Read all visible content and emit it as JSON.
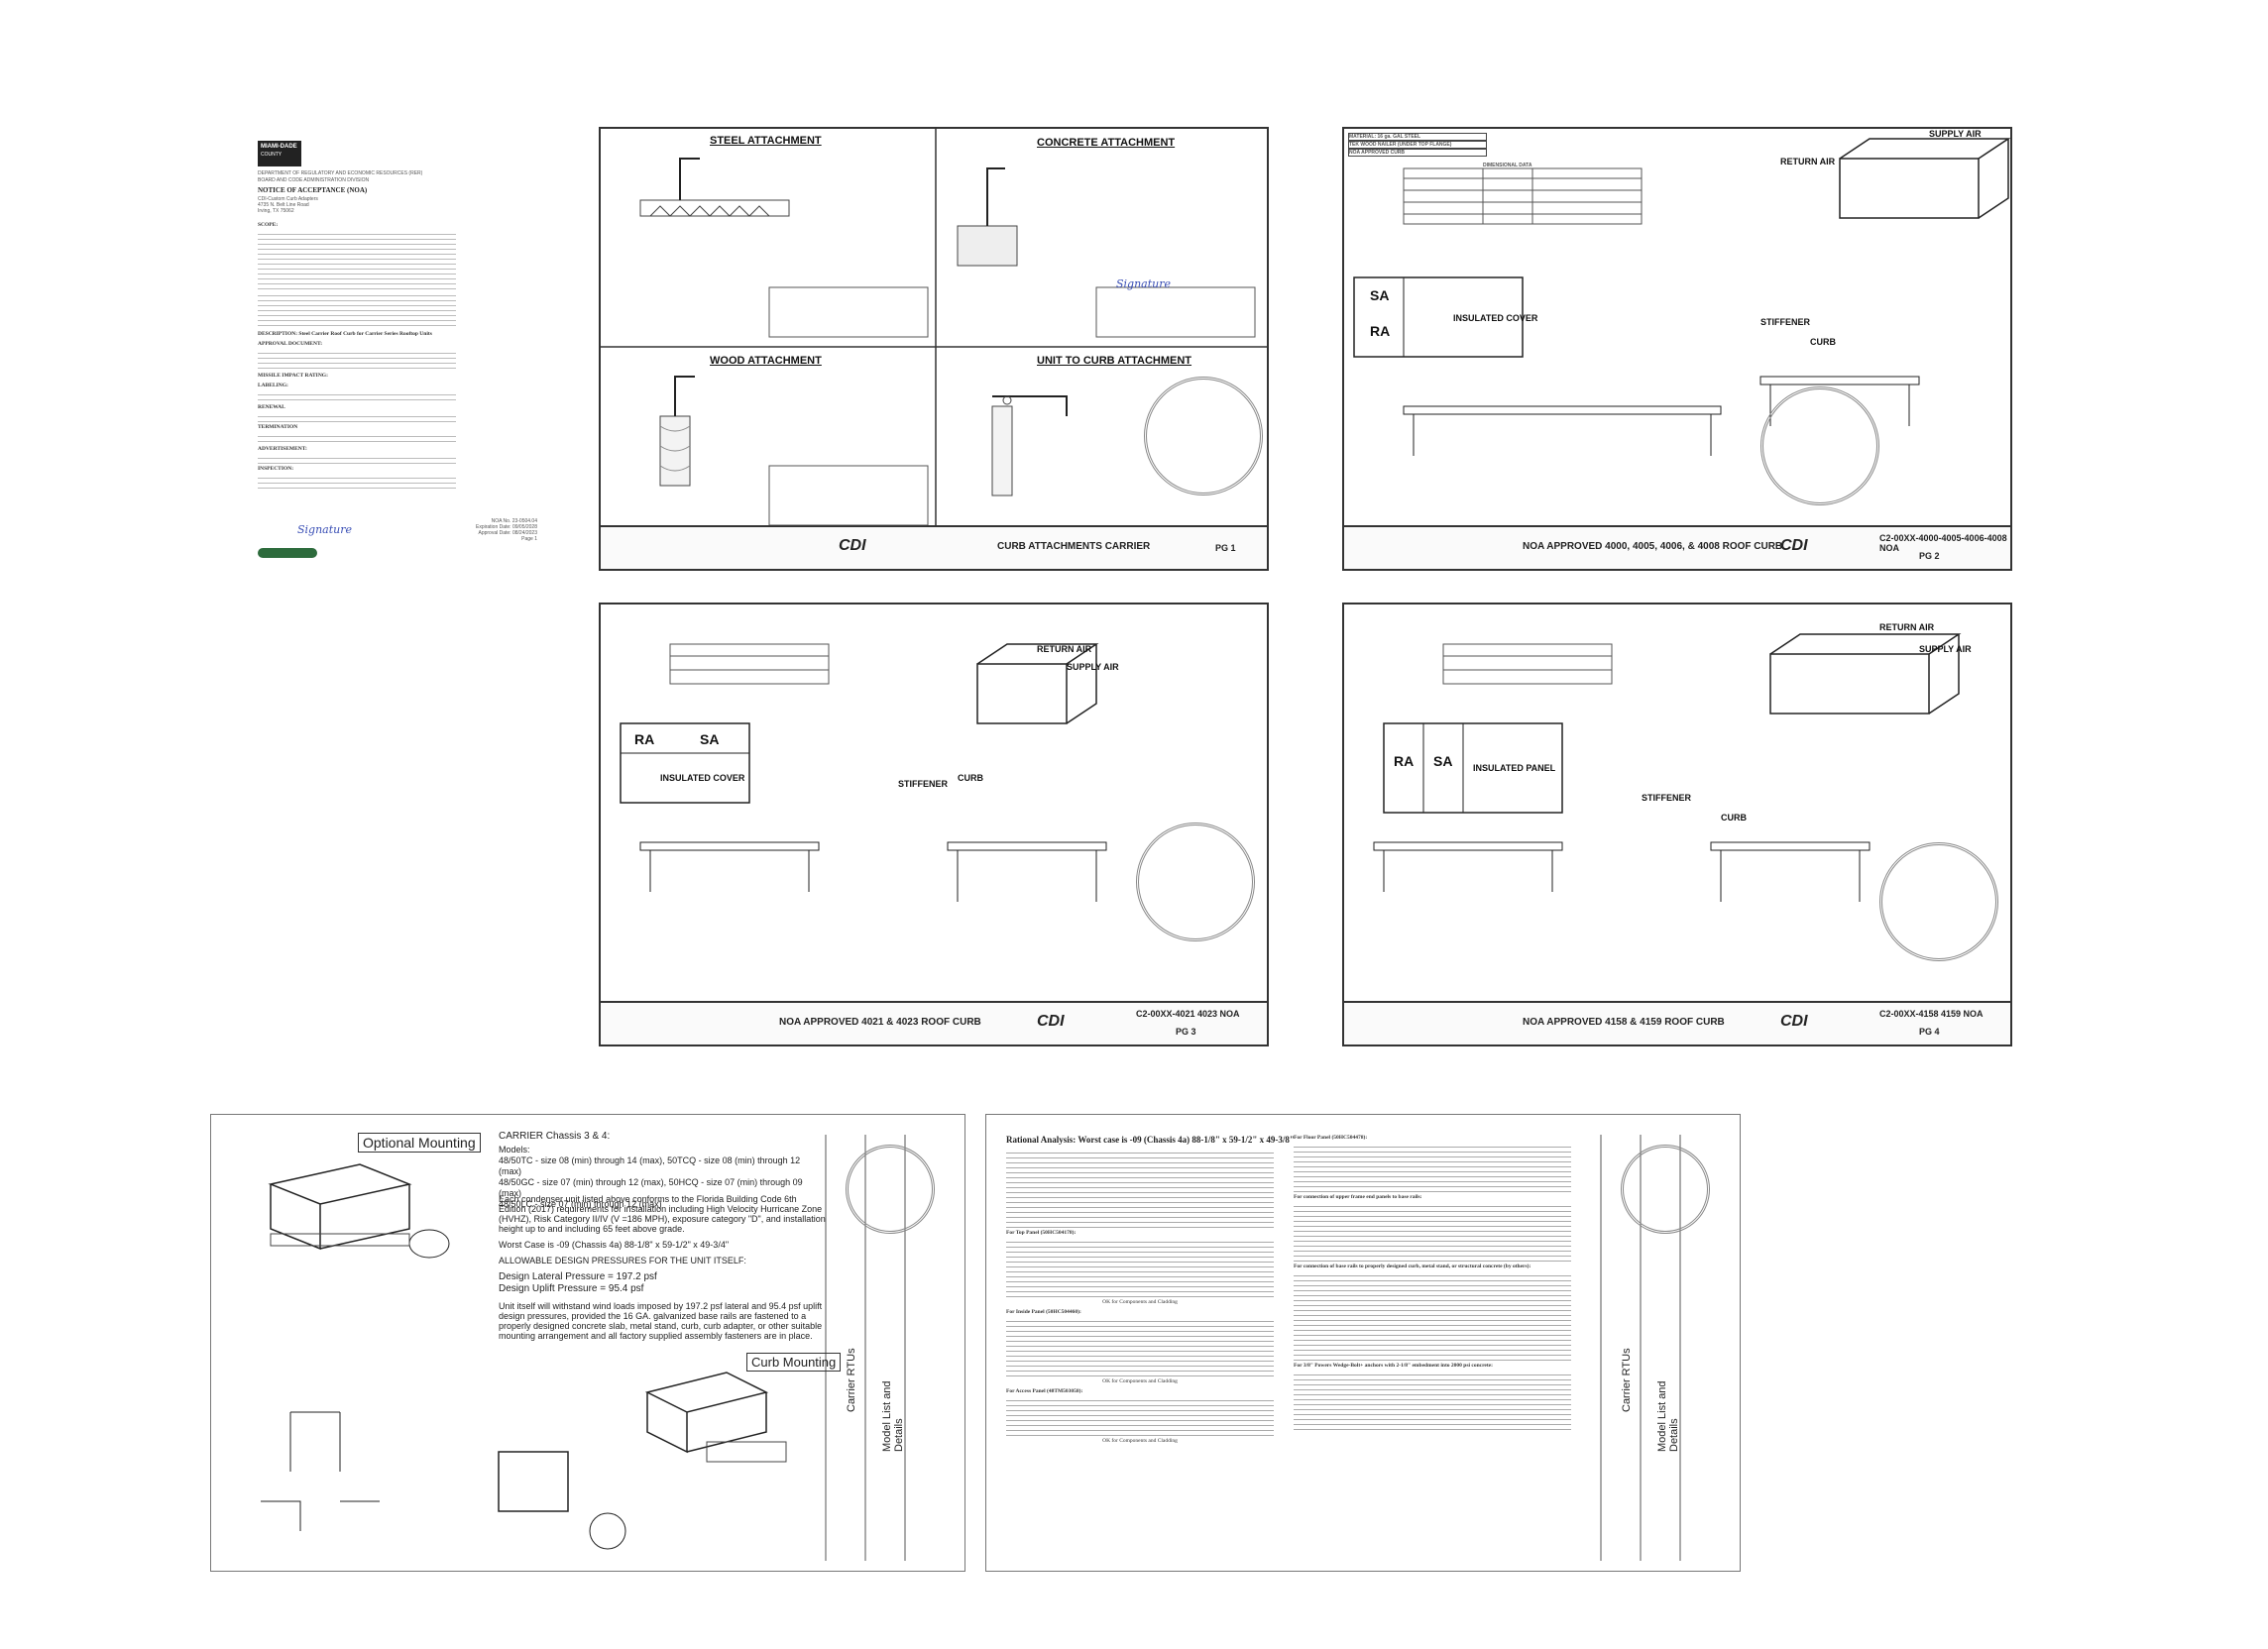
{
  "noa": {
    "logo_top": "MIAMI-DADE",
    "logo_bottom": "COUNTY",
    "dept": "DEPARTMENT OF REGULATORY AND ECONOMIC RESOURCES (RER)",
    "division": "BOARD AND CODE ADMINISTRATION DIVISION",
    "title": "NOTICE OF ACCEPTANCE (NOA)",
    "addressee": [
      "CDI-Custom Curb Adapters",
      "4735 N. Belt Line Road",
      "Irving, TX 75062"
    ],
    "description_label": "DESCRIPTION:",
    "description": "Steel Carrier Roof Curb for Carrier Series Rooftop Units",
    "sections": [
      "SCOPE:",
      "APPROVAL DOCUMENT:",
      "MISSILE IMPACT RATING:",
      "LABELING:",
      "RENEWAL",
      "TERMINATION",
      "ADVERTISEMENT:",
      "INSPECTION:"
    ],
    "noa_no": "NOA No. 23-0504.04",
    "expiration": "Expiration Date: 09/05/2028",
    "approval": "Approval Date: 08/24/2023",
    "page": "Page 1"
  },
  "pg1": {
    "steel": "STEEL ATTACHMENT",
    "concrete": "CONCRETE ATTACHMENT",
    "wood": "WOOD ATTACHMENT",
    "curb": "UNIT TO CURB ATTACHMENT",
    "title": "CURB ATTACHMENTS CARRIER",
    "page": "PG 1"
  },
  "pg2": {
    "table_hdr": [
      "MATERIAL: 16 ga. GAL STEEL",
      "TEK WOOD NAILER (UNDER TOP FLANGE)",
      "NOA APPROVED CURB"
    ],
    "dim": "DIMENSIONAL DATA",
    "labels": [
      "SUPPLY AIR",
      "RETURN AIR",
      "INSULATED COVER",
      "SA",
      "RA",
      "STIFFENER",
      "CURB"
    ],
    "title": "NOA APPROVED 4000, 4005, 4006, & 4008 ROOF CURB",
    "code": "C2-00XX-4000-4005-4006-4008 NOA",
    "page": "PG 2"
  },
  "pg3": {
    "labels": [
      "RETURN AIR",
      "SUPPLY AIR",
      "INSULATED COVER",
      "RA",
      "SA",
      "STIFFENER",
      "CURB"
    ],
    "title": "NOA APPROVED 4021 & 4023 ROOF CURB",
    "code": "C2-00XX-4021 4023 NOA",
    "page": "PG 3"
  },
  "pg4": {
    "labels": [
      "RETURN AIR",
      "SUPPLY AIR",
      "INSULATED PANEL",
      "RA",
      "SA",
      "STIFFENER",
      "CURB"
    ],
    "title": "NOA APPROVED 4158 & 4159 ROOF CURB",
    "code": "C2-00XX-4158 4159 NOA",
    "page": "PG 4"
  },
  "bottom_left": {
    "optional": "Optional Mounting",
    "curb": "Curb Mounting",
    "carrier_title": "CARRIER Chassis 3 & 4:",
    "models": [
      "Models:",
      "48/50TC - size 08 (min) through 14 (max), 50TCQ - size 08 (min) through 12 (max)",
      "48/50GC - size 07 (min) through 12 (max), 50HCQ - size 07 (min) through 09 (max)",
      "48/50LC - size 07 (min) through 12 (max)"
    ],
    "conform": "Each condenser unit listed above conforms to the Florida Building Code 6th Edition (2017) requirements for installation including High Velocity Hurricane Zone (HVHZ), Risk Category II/IV (V =186 MPH), exposure category \"D\", and installation height up to and including 65 feet above grade.",
    "worst": "Worst Case is -09 (Chassis 4a) 88-1/8\" x 59-1/2\" x 49-3/4\"",
    "allowable": "ALLOWABLE DESIGN PRESSURES FOR THE UNIT ITSELF:",
    "lateral": "Design Lateral Pressure = 197.2 psf",
    "uplift": "Design Uplift Pressure = 95.4 psf",
    "withstand": "Unit itself will withstand wind loads imposed by 197.2 psf lateral and 95.4 psf uplift design pressures, provided the 16 GA. galvanized base rails are fastened to a properly designed concrete slab, metal stand, curb, curb adapter, or other suitable mounting arrangement and all factory supplied assembly fasteners are in place.",
    "side1": "Carrier RTUs",
    "side2": "Model List and Details"
  },
  "bottom_right": {
    "title": "Rational Analysis:  Worst case is -09 (Chassis 4a)  88-1/8\" x 59-1/2\" x 49-3/8\"",
    "sections": [
      "For Top Panel (50HC504178):",
      "For Inside Panel (50HC504460):",
      "For Access Panel (48TM503058):",
      "For Floor Panel (50HC504478):",
      "For connection of upper frame end panels to base rails:",
      "For connection of base rails to properly designed curb, metal stand, or structural concrete (by others):",
      "For 3/8\" Powers Wedge-Bolt+ anchors with 2-1/8\" embedment into 2000 psi concrete:"
    ],
    "ok": "OK for Components and Cladding",
    "side1": "Carrier RTUs",
    "side2": "Model List and Details"
  }
}
